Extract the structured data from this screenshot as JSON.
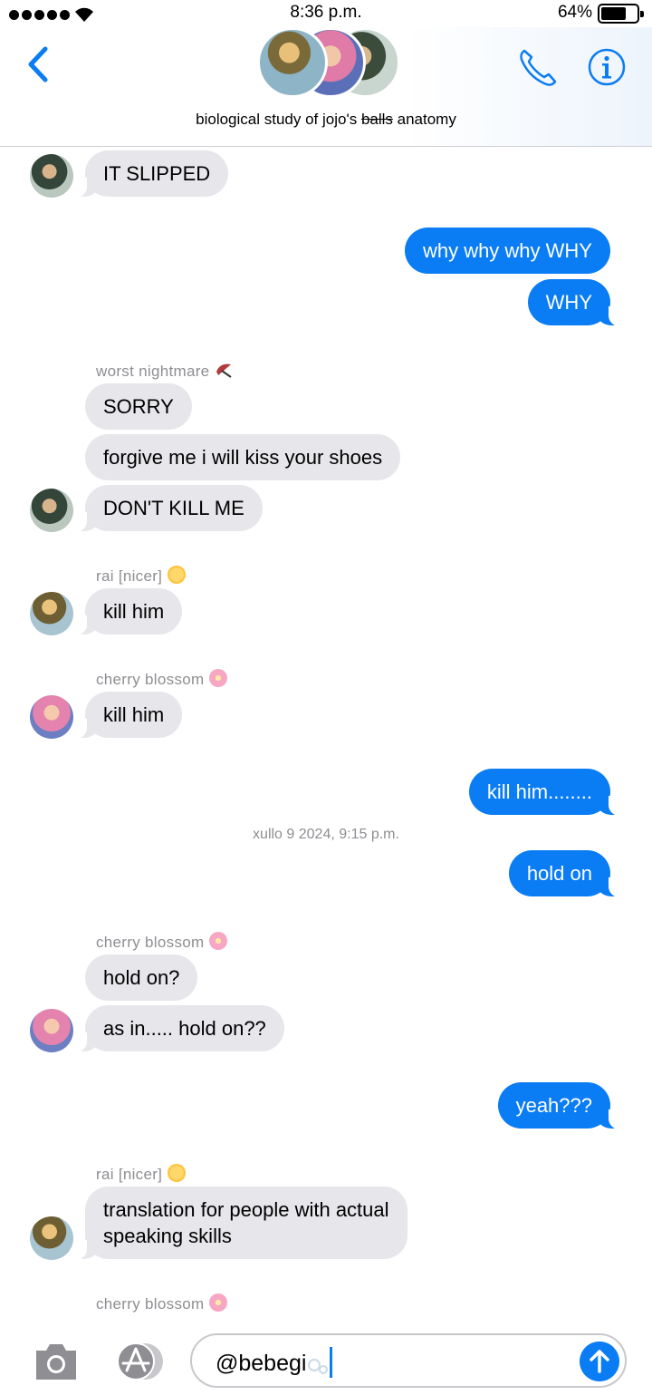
{
  "status_bar": {
    "time": "8:36 p.m.",
    "battery_percent": "64%",
    "battery_level": 0.64,
    "signal_bars": 5
  },
  "header": {
    "group_name_prefix": "biological study of jojo's ",
    "group_name_struck": "balls",
    "group_name_suffix": " anatomy",
    "icons": [
      "back-chevron-icon",
      "phone-icon",
      "info-icon"
    ],
    "accent_color": "#0a7cf4"
  },
  "messages": [
    {
      "id": "m1",
      "direction": "in",
      "text": "IT SLIPPED"
    },
    {
      "id": "m2",
      "direction": "out",
      "text": "why why why WHY"
    },
    {
      "id": "m3",
      "direction": "out",
      "text": "WHY"
    },
    {
      "id": "m4",
      "direction": "in",
      "sender": "worst nightmare",
      "text": "SORRY"
    },
    {
      "id": "m5",
      "direction": "in",
      "text": "forgive me i will kiss your shoes"
    },
    {
      "id": "m6",
      "direction": "in",
      "text": "DON'T KILL ME"
    },
    {
      "id": "m7",
      "direction": "in",
      "sender": "rai [nicer]",
      "text": "kill him"
    },
    {
      "id": "m8",
      "direction": "in",
      "sender": "cherry blossom",
      "text": "kill him"
    },
    {
      "id": "m9",
      "direction": "out",
      "text": "kill him........"
    },
    {
      "id": "m10",
      "direction": "out",
      "text": "hold on"
    },
    {
      "id": "m11",
      "direction": "in",
      "sender": "cherry blossom",
      "text": "hold on?"
    },
    {
      "id": "m12",
      "direction": "in",
      "text": "as in..... hold on??"
    },
    {
      "id": "m13",
      "direction": "out",
      "text": "yeah???"
    },
    {
      "id": "m14",
      "direction": "in",
      "sender": "rai [nicer]",
      "text_line1": "translation for people with actual",
      "text_line2": "speaking skills"
    }
  ],
  "senders": {
    "nightmare": "worst nightmare",
    "rai": "rai [nicer]",
    "cherry": "cherry blossom"
  },
  "timestamp": "xullo 9 2024, 9:15 p.m.",
  "input": {
    "value": "@bebegi",
    "icons": [
      "camera-icon",
      "app-store-icon",
      "send-arrow-icon"
    ]
  }
}
